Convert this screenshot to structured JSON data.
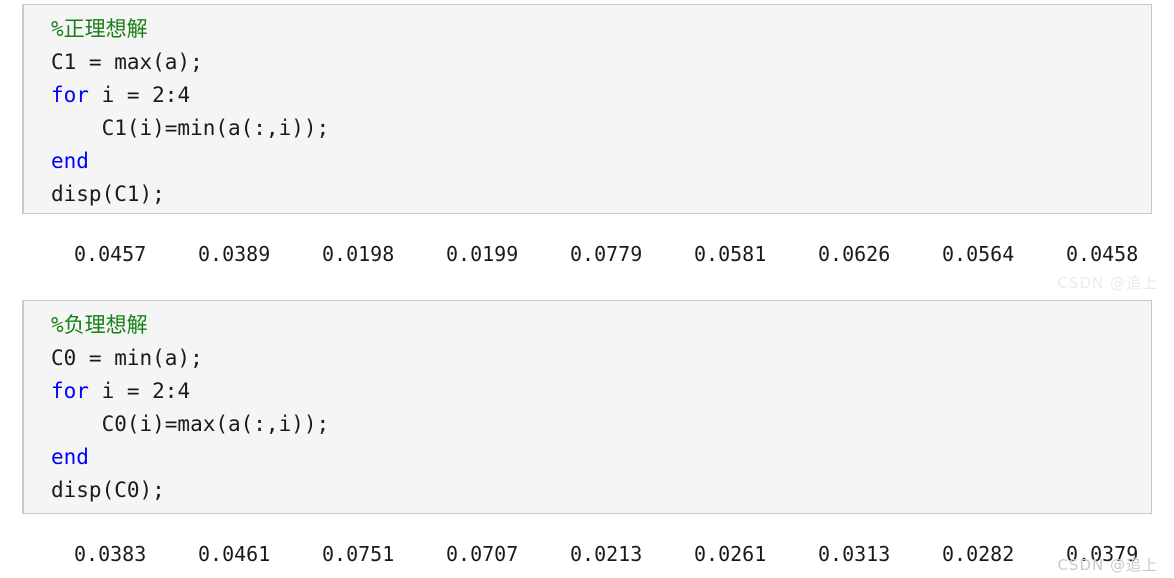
{
  "blocks": [
    {
      "id": "block-1",
      "lines": [
        {
          "segments": [
            {
              "type": "comment",
              "text": "%正理想解"
            }
          ]
        },
        {
          "segments": [
            {
              "type": "plain",
              "text": "C1 = max(a);"
            }
          ]
        },
        {
          "segments": [
            {
              "type": "keyword",
              "text": "for"
            },
            {
              "type": "plain",
              "text": " i = 2:4"
            }
          ]
        },
        {
          "segments": [
            {
              "type": "plain",
              "text": "    C1(i)=min(a(:,i));"
            }
          ]
        },
        {
          "segments": [
            {
              "type": "keyword",
              "text": "end"
            }
          ]
        },
        {
          "segments": [
            {
              "type": "plain",
              "text": "disp(C1);"
            }
          ]
        }
      ]
    },
    {
      "id": "block-2",
      "lines": [
        {
          "segments": [
            {
              "type": "comment",
              "text": "%负理想解"
            }
          ]
        },
        {
          "segments": [
            {
              "type": "plain",
              "text": "C0 = min(a);"
            }
          ]
        },
        {
          "segments": [
            {
              "type": "keyword",
              "text": "for"
            },
            {
              "type": "plain",
              "text": " i = 2:4"
            }
          ]
        },
        {
          "segments": [
            {
              "type": "plain",
              "text": "    C0(i)=max(a(:,i));"
            }
          ]
        },
        {
          "segments": [
            {
              "type": "keyword",
              "text": "end"
            }
          ]
        },
        {
          "segments": [
            {
              "type": "plain",
              "text": "disp(C0);"
            }
          ]
        }
      ]
    }
  ],
  "outputs": [
    {
      "id": "output-1",
      "values": [
        "0.0457",
        "0.0389",
        "0.0198",
        "0.0199",
        "0.0779",
        "0.0581",
        "0.0626",
        "0.0564",
        "0.0458"
      ]
    },
    {
      "id": "output-2",
      "values": [
        "0.0383",
        "0.0461",
        "0.0751",
        "0.0707",
        "0.0213",
        "0.0261",
        "0.0313",
        "0.0282",
        "0.0379"
      ]
    }
  ],
  "watermarks": {
    "top": "CSDN @追上",
    "bottom": "CSDN @追上"
  },
  "colors": {
    "comment": "#178017",
    "keyword": "#0000ff",
    "plain": "#1a1a1a",
    "block_background": "#f5f5f5",
    "block_border": "#c9c9c9",
    "page_background": "#ffffff",
    "watermark": "#c9c9c9"
  }
}
